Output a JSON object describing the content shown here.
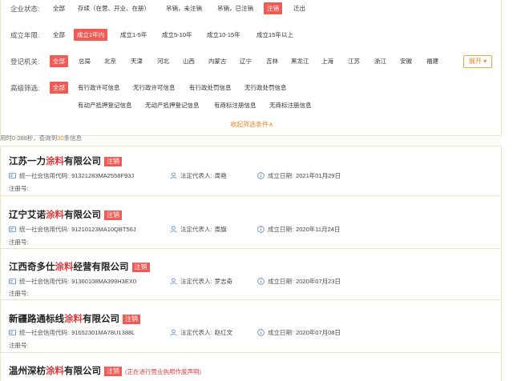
{
  "filters": {
    "status": {
      "label": "企业状态:",
      "options": [
        "全部",
        "存续（在营、开业、在册）",
        "吊销，未注销",
        "吊销，已注销",
        "注销",
        "迁出"
      ],
      "selected": 4
    },
    "age": {
      "label": "成立年限:",
      "options": [
        "全部",
        "成立1年内",
        "成立1-5年",
        "成立5-10年",
        "成立10-15年",
        "成立15年以上"
      ],
      "selected": 1
    },
    "region": {
      "label": "登记机关:",
      "options": [
        "全部",
        "总局",
        "北京",
        "天津",
        "河北",
        "山西",
        "内蒙古",
        "辽宁",
        "吉林",
        "黑龙江",
        "上海",
        "江苏",
        "浙江",
        "安徽",
        "福建"
      ],
      "selected": 0,
      "expand_label": "展开"
    },
    "advanced": {
      "label": "高级筛选:",
      "row1": [
        "全部",
        "有行政许可信息",
        "无行政许可信息",
        "有行政处罚信息",
        "无行政处罚信息"
      ],
      "row2": [
        "有动产抵押登记信息",
        "无动产抵押登记信息",
        "有商标注册信息",
        "无商标注册信息"
      ],
      "selected": 0
    },
    "collapse_label": "收起筛选条件∧"
  },
  "summary": {
    "prefix": "用时0.088秒，查询到",
    "count": "30",
    "suffix": "条信息"
  },
  "field_labels": {
    "credit_code": "统一社会信用代码:",
    "legal_rep": "法定代表人:",
    "founded": "成立日期:",
    "reg_no": "注册号:"
  },
  "companies": [
    {
      "name_pre": "江苏一力",
      "name_hl": "涂料",
      "name_post": "有限公司",
      "status": "注销",
      "note": "",
      "credit_code": "91321283MA2558F93J",
      "legal_rep": "周艳",
      "founded": "2021年01月29日"
    },
    {
      "name_pre": "辽宁艾诺",
      "name_hl": "涂料",
      "name_post": "有限公司",
      "status": "注销",
      "note": "",
      "credit_code": "91210123MA10QBT56J",
      "legal_rep": "周旗",
      "founded": "2020年11月24日"
    },
    {
      "name_pre": "江西奇多仕",
      "name_hl": "涂料",
      "name_post": "经营有限公司",
      "status": "注销",
      "note": "",
      "credit_code": "91360108MA399H3EX0",
      "legal_rep": "罗志奇",
      "founded": "2020年07月23日"
    },
    {
      "name_pre": "新疆路通标线",
      "name_hl": "涂料",
      "name_post": "有限公司",
      "status": "注销",
      "note": "",
      "credit_code": "91652301MA78U1388L",
      "legal_rep": "赵红文",
      "founded": "2020年07月08日"
    },
    {
      "name_pre": "温州深枋",
      "name_hl": "涂料",
      "name_post": "有限公司",
      "status": "注销",
      "note": "(正在进行营业执照作废声明)",
      "credit_code": "",
      "legal_rep": "",
      "founded": ""
    }
  ],
  "colors": {
    "accent": "#f25a55",
    "highlight": "#e4393c",
    "orange": "#e8892b",
    "border": "#f0e3c4"
  }
}
